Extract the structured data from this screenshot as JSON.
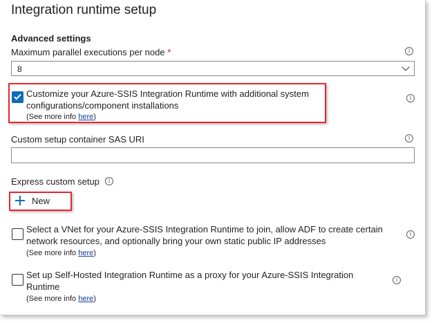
{
  "title": "Integration runtime setup",
  "advanced": {
    "header": "Advanced settings",
    "max_parallel_label": "Maximum parallel executions per node",
    "required_mark": "*",
    "max_parallel_value": "8"
  },
  "customize": {
    "text": "Customize your Azure-SSIS Integration Runtime with additional system configurations/component installations",
    "see_more_prefix": "(See more info ",
    "link": "here",
    "see_more_suffix": ")",
    "checked": true
  },
  "sas": {
    "label": "Custom setup container SAS URI",
    "value": ""
  },
  "express": {
    "label": "Express custom setup",
    "new_label": "New"
  },
  "vnet": {
    "text": "Select a VNet for your Azure-SSIS Integration Runtime to join, allow ADF to create certain network resources, and optionally bring your own static public IP addresses",
    "see_more_prefix": "(See more info ",
    "link": "here",
    "see_more_suffix": ")",
    "checked": false
  },
  "proxy": {
    "text": "Set up Self-Hosted Integration Runtime as a proxy for your Azure-SSIS Integration Runtime",
    "see_more_prefix": "(See more info ",
    "link": "here",
    "see_more_suffix": ")",
    "checked": false
  },
  "icons": {
    "info": "info-icon",
    "chevron": "chevron-down-icon",
    "plus": "plus-icon",
    "check": "checkmark-icon"
  },
  "colors": {
    "accent": "#0f6cbd",
    "highlight": "#e3262d",
    "required": "#c50f1f"
  }
}
